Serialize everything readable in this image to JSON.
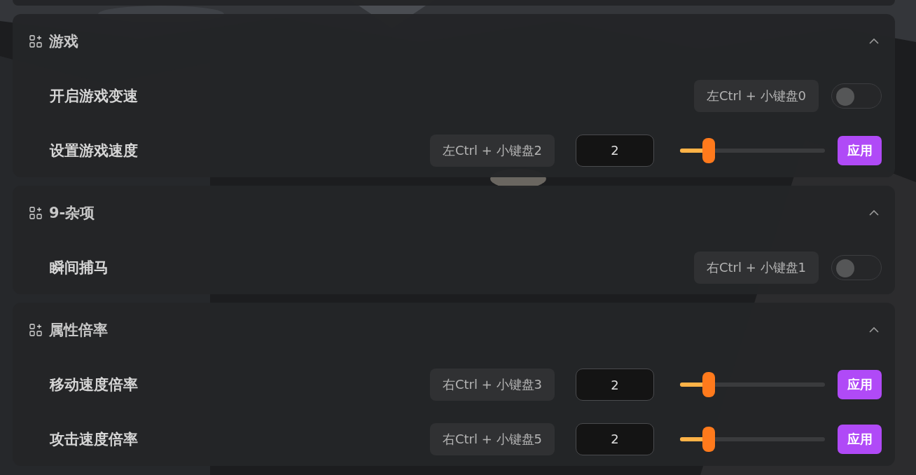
{
  "sections": [
    {
      "title": "游戏",
      "expanded": true,
      "rows": [
        {
          "kind": "toggle",
          "label": "开启游戏变速",
          "hotkey": "左Ctrl + 小键盘0",
          "on": false
        },
        {
          "kind": "slider",
          "label": "设置游戏速度",
          "hotkey": "左Ctrl + 小键盘2",
          "value": "2",
          "level": 0.2,
          "button": "应用"
        }
      ]
    },
    {
      "title": "9-杂项",
      "expanded": true,
      "rows": [
        {
          "kind": "toggle",
          "label": "瞬间捕马",
          "hotkey": "右Ctrl + 小键盘1",
          "on": false
        }
      ]
    },
    {
      "title": "属性倍率",
      "expanded": true,
      "rows": [
        {
          "kind": "slider",
          "label": "移动速度倍率",
          "hotkey": "右Ctrl + 小键盘3",
          "value": "2",
          "level": 0.2,
          "button": "应用"
        },
        {
          "kind": "slider",
          "label": "攻击速度倍率",
          "hotkey": "右Ctrl + 小键盘5",
          "value": "2",
          "level": 0.2,
          "button": "应用"
        }
      ]
    }
  ]
}
